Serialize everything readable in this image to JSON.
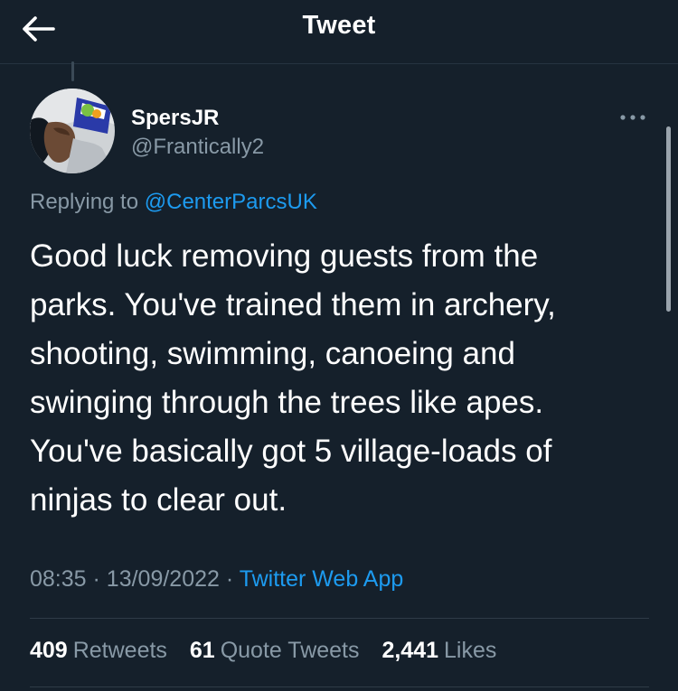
{
  "header": {
    "title": "Tweet",
    "back_icon": "arrow-left-icon"
  },
  "tweet": {
    "author": {
      "display_name": "SpersJR",
      "handle": "@Frantically2"
    },
    "replying_prefix": "Replying to",
    "replying_to": "@CenterParcsUK",
    "text": "Good luck removing guests from the\nparks. You've trained them in archery,\nshooting, swimming, canoeing and\nswinging through the trees like apes.\nYou've basically got 5 village-loads of\nninjas to clear out.",
    "time": "08:35",
    "date": "13/09/2022",
    "separator": "·",
    "source": "Twitter Web App"
  },
  "stats": {
    "retweets": {
      "count": "409",
      "label": "Retweets"
    },
    "quote_tweets": {
      "count": "61",
      "label": "Quote Tweets"
    },
    "likes": {
      "count": "2,441",
      "label": "Likes"
    }
  },
  "colors": {
    "background": "#15202b",
    "accent": "#1d9bf0",
    "secondary_text": "#8899a6"
  }
}
